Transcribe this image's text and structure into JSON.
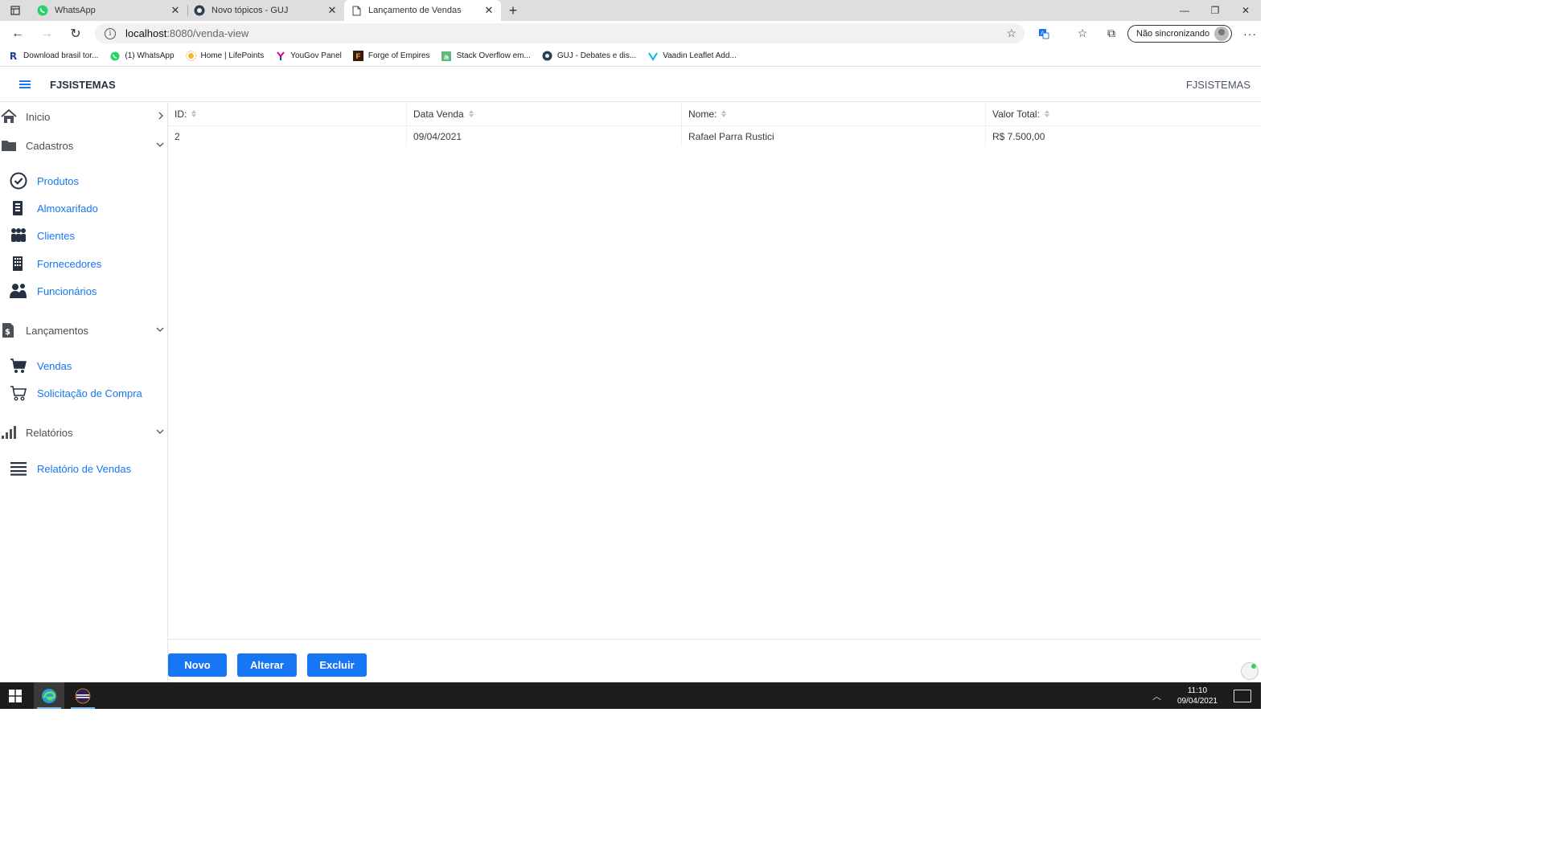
{
  "browser": {
    "tabs": [
      {
        "title": "WhatsApp",
        "icon": "whatsapp-icon",
        "active": false
      },
      {
        "title": "Novo tópicos - GUJ",
        "icon": "guj-icon",
        "active": false
      },
      {
        "title": "Lançamento de Vendas",
        "icon": "page-icon",
        "active": true
      }
    ],
    "url_host": "localhost",
    "url_rest": ":8080/venda-view",
    "profile_label": "Não sincronizando",
    "bookmarks": [
      {
        "label": "Download brasil tor...",
        "icon": "R"
      },
      {
        "label": "(1) WhatsApp",
        "icon": "whatsapp"
      },
      {
        "label": "Home | LifePoints",
        "icon": "sun"
      },
      {
        "label": "YouGov Panel",
        "icon": "y"
      },
      {
        "label": "Forge of Empires",
        "icon": "F"
      },
      {
        "label": "Stack Overflow em...",
        "icon": "so"
      },
      {
        "label": "GUJ - Debates e dis...",
        "icon": "guj"
      },
      {
        "label": "Vaadin Leaflet Add...",
        "icon": "v"
      }
    ]
  },
  "app": {
    "title": "FJSISTEMAS",
    "title_right": "FJSISTEMAS",
    "accent": "#1676f3"
  },
  "sidebar": {
    "inicio": "Inicio",
    "cadastros": "Cadastros",
    "cadastros_items": [
      "Produtos",
      "Almoxarifado",
      "Clientes",
      "Fornecedores",
      "Funcionários"
    ],
    "lancamentos": "Lançamentos",
    "lancamentos_items": [
      "Vendas",
      "Solicitação de Compra"
    ],
    "relatorios": "Relatórios",
    "relatorios_items": [
      "Relatório de Vendas"
    ]
  },
  "grid": {
    "columns": [
      "ID:",
      "Data Venda",
      "Nome:",
      "Valor Total:"
    ],
    "rows": [
      [
        "2",
        "09/04/2021",
        "Rafael Parra Rustici",
        "R$ 7.500,00"
      ]
    ]
  },
  "actions": {
    "novo": "Novo",
    "alterar": "Alterar",
    "excluir": "Excluir"
  },
  "taskbar": {
    "time": "11:10",
    "date": "09/04/2021"
  }
}
